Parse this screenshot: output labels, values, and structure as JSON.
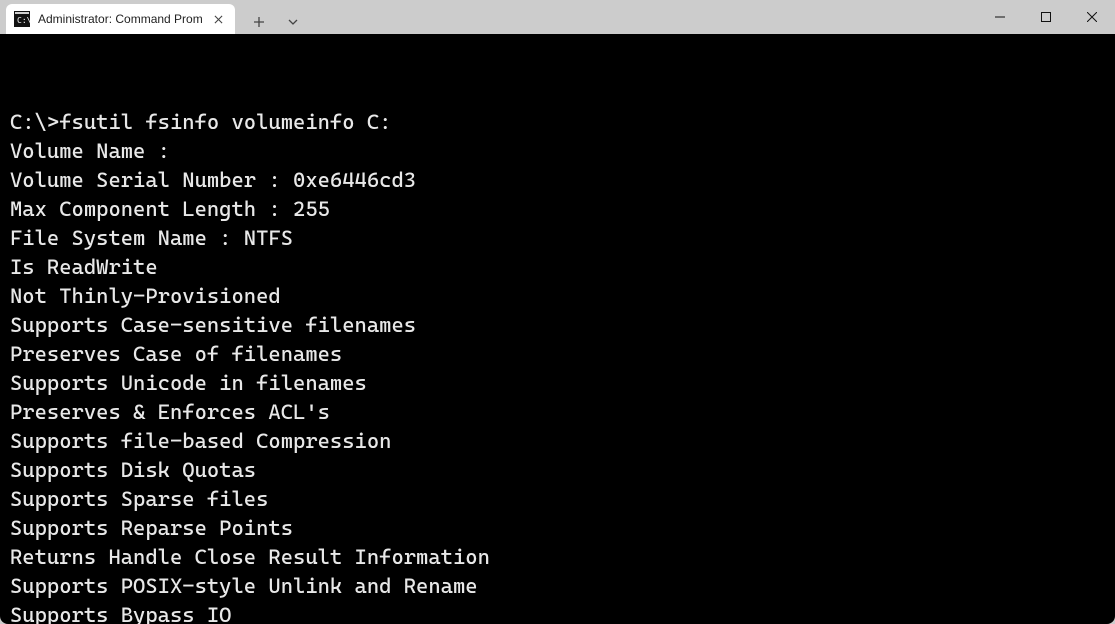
{
  "tab": {
    "title": "Administrator: Command Prom",
    "icon": "cmd"
  },
  "terminal": {
    "prompt": "C:\\>",
    "command": "fsutil fsinfo volumeinfo C:",
    "lines": [
      "Volume Name :",
      "Volume Serial Number : 0xe6446cd3",
      "Max Component Length : 255",
      "File System Name : NTFS",
      "Is ReadWrite",
      "Not Thinly-Provisioned",
      "Supports Case-sensitive filenames",
      "Preserves Case of filenames",
      "Supports Unicode in filenames",
      "Preserves & Enforces ACL's",
      "Supports file-based Compression",
      "Supports Disk Quotas",
      "Supports Sparse files",
      "Supports Reparse Points",
      "Returns Handle Close Result Information",
      "Supports POSIX-style Unlink and Rename",
      "Supports Bypass IO"
    ]
  }
}
